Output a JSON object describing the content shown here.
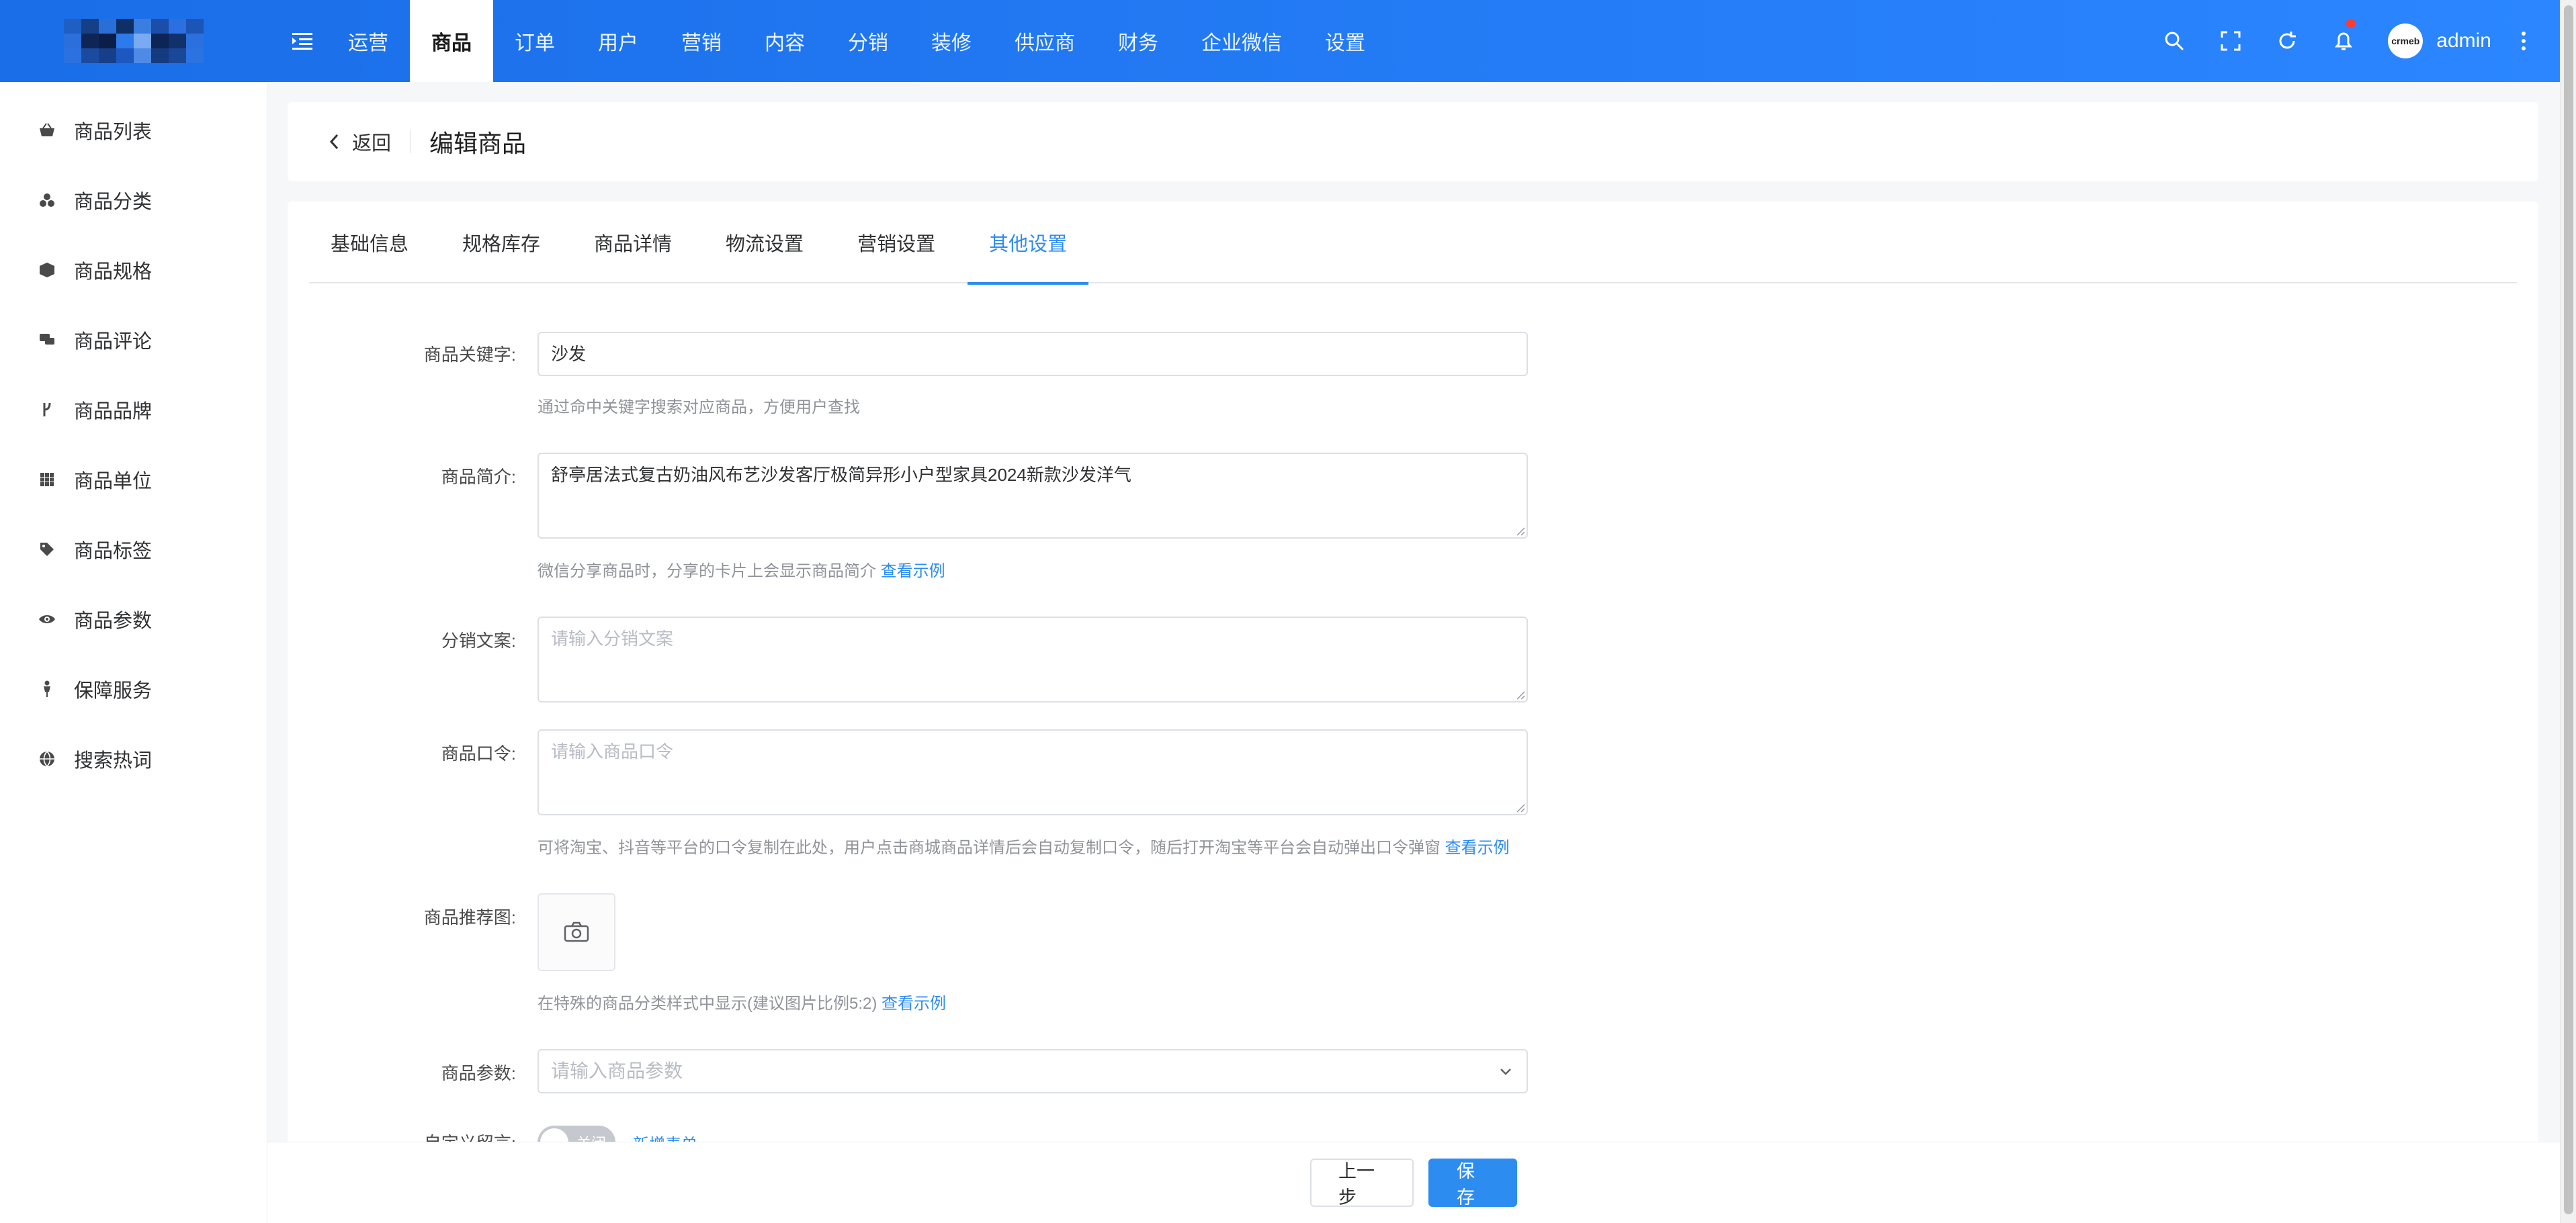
{
  "colors": {
    "topbar_start": "#1a6ee8",
    "topbar_end": "#2b86ff",
    "accent": "#2d8cf0",
    "badge": "#ff3b30"
  },
  "top_nav": {
    "items": [
      {
        "label": "运营"
      },
      {
        "label": "商品"
      },
      {
        "label": "订单"
      },
      {
        "label": "用户"
      },
      {
        "label": "营销"
      },
      {
        "label": "内容"
      },
      {
        "label": "分销"
      },
      {
        "label": "装修"
      },
      {
        "label": "供应商"
      },
      {
        "label": "财务"
      },
      {
        "label": "企业微信"
      },
      {
        "label": "设置"
      }
    ],
    "active_index": 1
  },
  "user": {
    "name": "admin",
    "avatar_text": "crmeb"
  },
  "sidebar": {
    "items": [
      {
        "label": "商品列表",
        "icon": "basket-icon"
      },
      {
        "label": "商品分类",
        "icon": "category-icon"
      },
      {
        "label": "商品规格",
        "icon": "cube-icon"
      },
      {
        "label": "商品评论",
        "icon": "comment-icon"
      },
      {
        "label": "商品品牌",
        "icon": "brand-icon"
      },
      {
        "label": "商品单位",
        "icon": "grid-icon"
      },
      {
        "label": "商品标签",
        "icon": "tag-icon"
      },
      {
        "label": "商品参数",
        "icon": "eye-icon"
      },
      {
        "label": "保障服务",
        "icon": "service-icon"
      },
      {
        "label": "搜索热词",
        "icon": "globe-icon"
      }
    ]
  },
  "header": {
    "back_label": "返回",
    "title": "编辑商品"
  },
  "tabs": {
    "items": [
      {
        "label": "基础信息"
      },
      {
        "label": "规格库存"
      },
      {
        "label": "商品详情"
      },
      {
        "label": "物流设置"
      },
      {
        "label": "营销设置"
      },
      {
        "label": "其他设置"
      }
    ],
    "active_index": 5
  },
  "form": {
    "keyword": {
      "label": "商品关键字:",
      "value": "沙发",
      "hint": "通过命中关键字搜索对应商品，方便用户查找"
    },
    "intro": {
      "label": "商品简介:",
      "value": "舒亭居法式复古奶油风布艺沙发客厅极简异形小户型家具2024新款沙发洋气",
      "hint": "微信分享商品时，分享的卡片上会显示商品简介",
      "hint_link": "查看示例"
    },
    "distribution": {
      "label": "分销文案:",
      "placeholder": "请输入分销文案"
    },
    "command": {
      "label": "商品口令:",
      "placeholder": "请输入商品口令",
      "hint": "可将淘宝、抖音等平台的口令复制在此处，用户点击商城商品详情后会自动复制口令，随后打开淘宝等平台会自动弹出口令弹窗",
      "hint_link": "查看示例"
    },
    "recommend_image": {
      "label": "商品推荐图:",
      "hint": "在特殊的商品分类样式中显示(建议图片比例5:2)",
      "hint_link": "查看示例"
    },
    "params": {
      "label": "商品参数:",
      "placeholder": "请输入商品参数"
    },
    "custom_message": {
      "label": "自定义留言:",
      "switch_text": "关闭",
      "link": "新增表单"
    }
  },
  "footer": {
    "prev_label": "上一步",
    "save_label": "保存"
  }
}
